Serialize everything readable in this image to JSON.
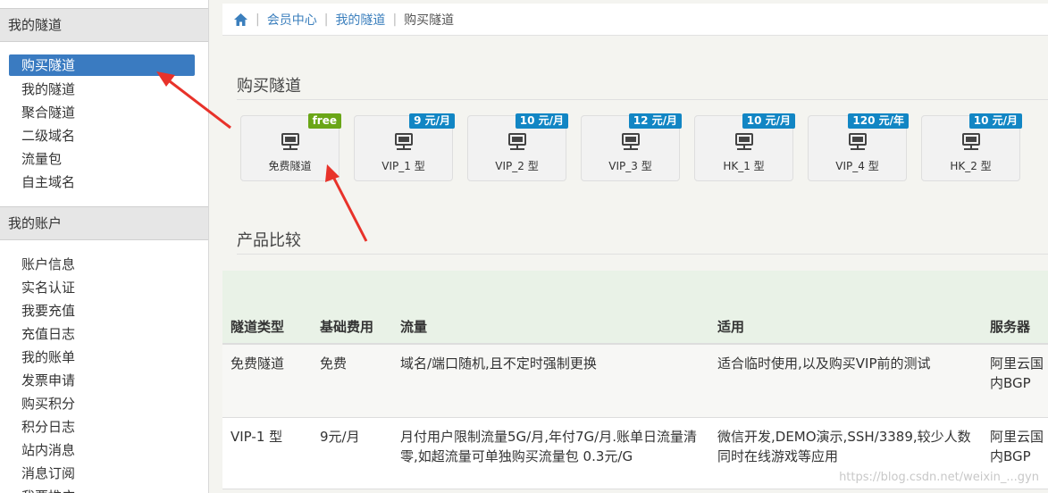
{
  "sidebar": {
    "section1_title": "我的隧道",
    "section1_items": [
      "购买隧道",
      "我的隧道",
      "聚合隧道",
      "二级域名",
      "流量包",
      "自主域名"
    ],
    "section2_title": "我的账户",
    "section2_items": [
      "账户信息",
      "实名认证",
      "我要充值",
      "充值日志",
      "我的账单",
      "发票申请",
      "购买积分",
      "积分日志",
      "站内消息",
      "消息订阅",
      "我要推广"
    ]
  },
  "breadcrumb": {
    "items": [
      "会员中心",
      "我的隧道",
      "购买隧道"
    ]
  },
  "main": {
    "buy_title": "购买隧道",
    "compare_title": "产品比较",
    "tiles": [
      {
        "label": "免费隧道",
        "badge": "free",
        "badge_color": "#6aa617"
      },
      {
        "label": "VIP_1 型",
        "badge": "9 元/月",
        "badge_color": "#1286c4"
      },
      {
        "label": "VIP_2 型",
        "badge": "10 元/月",
        "badge_color": "#1286c4"
      },
      {
        "label": "VIP_3 型",
        "badge": "12 元/月",
        "badge_color": "#1286c4"
      },
      {
        "label": "HK_1 型",
        "badge": "10 元/月",
        "badge_color": "#1286c4"
      },
      {
        "label": "VIP_4 型",
        "badge": "120 元/年",
        "badge_color": "#1286c4"
      },
      {
        "label": "HK_2 型",
        "badge": "10 元/月",
        "badge_color": "#1286c4"
      }
    ],
    "table": {
      "headers": [
        "隧道类型",
        "基础费用",
        "流量",
        "适用",
        "服务器"
      ],
      "rows": [
        [
          "免费隧道",
          "免费",
          "域名/端口随机,且不定时强制更换",
          "适合临时使用,以及购买VIP前的测试",
          "阿里云国内BGP"
        ],
        [
          "VIP-1 型",
          "9元/月",
          "月付用户限制流量5G/月,年付7G/月.账单日流量清零,如超流量可单独购买流量包 0.3元/G",
          "微信开发,DEMO演示,SSH/3389,较少人数同时在线游戏等应用",
          "阿里云国内BGP"
        ]
      ]
    }
  },
  "watermark": "https://blog.csdn.net/weixin_...gyn",
  "colors": {
    "accent": "#3a7bc1",
    "arrow": "#e8322a"
  }
}
